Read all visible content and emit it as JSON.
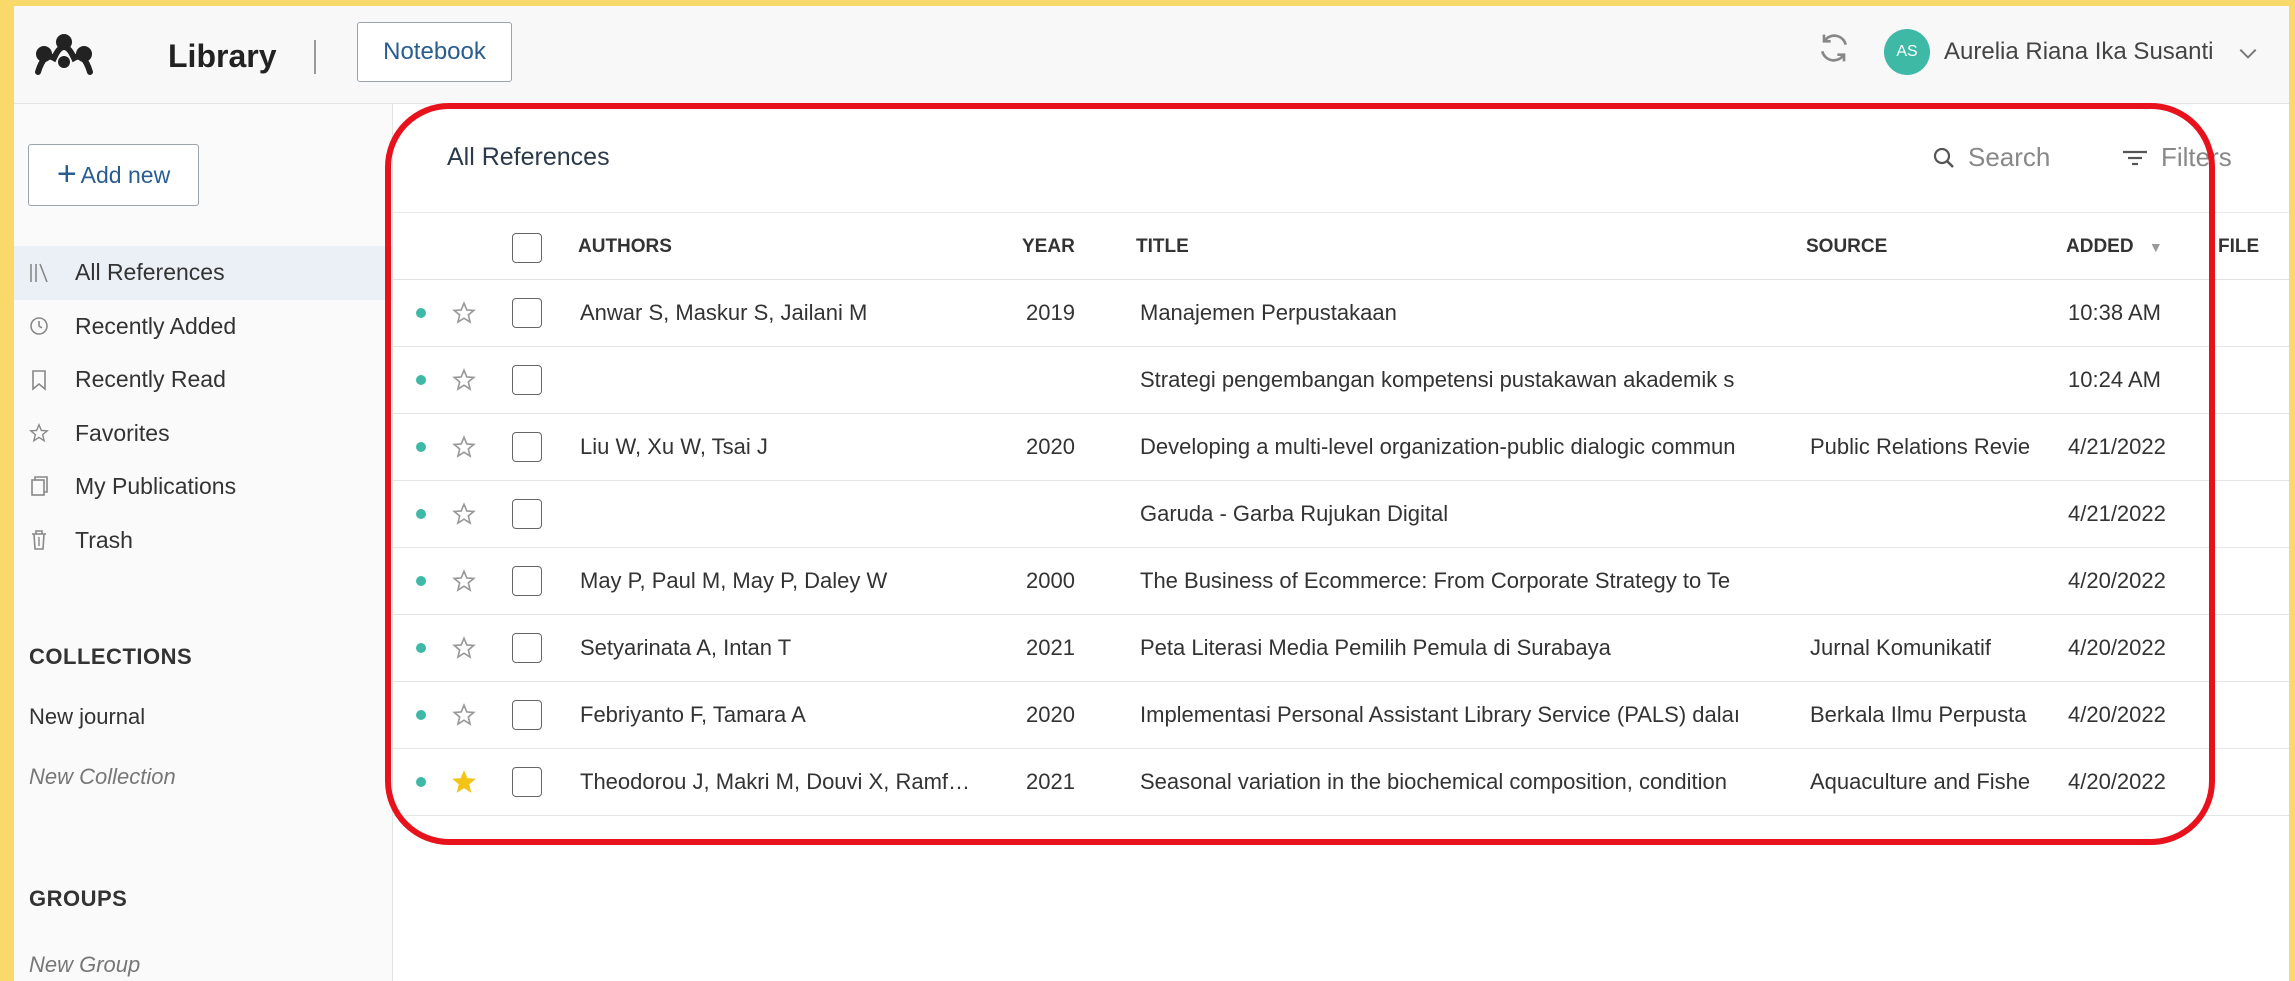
{
  "app": {
    "title": "Library",
    "notebook_label": "Notebook"
  },
  "user": {
    "initials": "AS",
    "name": "Aurelia Riana Ika Susanti",
    "avatar_color": "#3eb9a6"
  },
  "sidebar": {
    "add_new_label": "Add new",
    "items": [
      {
        "label": "All References",
        "icon": "library-icon",
        "active": true
      },
      {
        "label": "Recently Added",
        "icon": "clock-icon"
      },
      {
        "label": "Recently Read",
        "icon": "bookmark-icon"
      },
      {
        "label": "Favorites",
        "icon": "star-icon"
      },
      {
        "label": "My Publications",
        "icon": "publications-icon"
      },
      {
        "label": "Trash",
        "icon": "trash-icon"
      }
    ],
    "collections_heading": "COLLECTIONS",
    "collections": [
      "New journal"
    ],
    "new_collection_label": "New Collection",
    "groups_heading": "GROUPS",
    "new_group_label": "New Group"
  },
  "main": {
    "title": "All References",
    "search_label": "Search",
    "filters_label": "Filters",
    "columns": {
      "authors": "AUTHORS",
      "year": "YEAR",
      "title": "TITLE",
      "source": "SOURCE",
      "added": "ADDED",
      "file": "FILE"
    },
    "rows": [
      {
        "authors": "Anwar S, Maskur S, Jailani M",
        "year": "2019",
        "title": "Manajemen Perpustakaan",
        "source": "",
        "added": "10:38 AM",
        "starred": false
      },
      {
        "authors": "",
        "year": "",
        "title": "Strategi pengembangan kompetensi pustakawan akademik s",
        "source": "",
        "added": "10:24 AM",
        "starred": false
      },
      {
        "authors": "Liu W, Xu W, Tsai J",
        "year": "2020",
        "title": "Developing a multi-level organization-public dialogic commun",
        "source": "Public Relations Revie",
        "added": "4/21/2022",
        "starred": false
      },
      {
        "authors": "",
        "year": "",
        "title": "Garuda - Garba Rujukan Digital",
        "source": "",
        "added": "4/21/2022",
        "starred": false
      },
      {
        "authors": "May P, Paul M, May P, Daley W",
        "year": "2000",
        "title": "The Business of Ecommerce: From Corporate Strategy to Te",
        "source": "",
        "added": "4/20/2022",
        "starred": false
      },
      {
        "authors": "Setyarinata A, Intan T",
        "year": "2021",
        "title": "Peta Literasi Media Pemilih Pemula di Surabaya",
        "source": "Jurnal Komunikatif",
        "added": "4/20/2022",
        "starred": false
      },
      {
        "authors": "Febriyanto F, Tamara A",
        "year": "2020",
        "title": "Implementasi Personal Assistant Library Service (PALS) dalaı",
        "source": "Berkala Ilmu Perpusta",
        "added": "4/20/2022",
        "starred": false
      },
      {
        "authors": "Theodorou J, Makri M, Douvi X, Ramf…",
        "year": "2021",
        "title": "Seasonal variation in the biochemical composition, condition",
        "source": "Aquaculture and Fishe",
        "added": "4/20/2022",
        "starred": true
      }
    ]
  },
  "colors": {
    "accent_teal": "#3eb9a6",
    "highlight_red": "#e8121d",
    "star_yellow": "#f3c316",
    "frame_yellow": "#f9d96a",
    "link_blue": "#2a5d8f"
  }
}
